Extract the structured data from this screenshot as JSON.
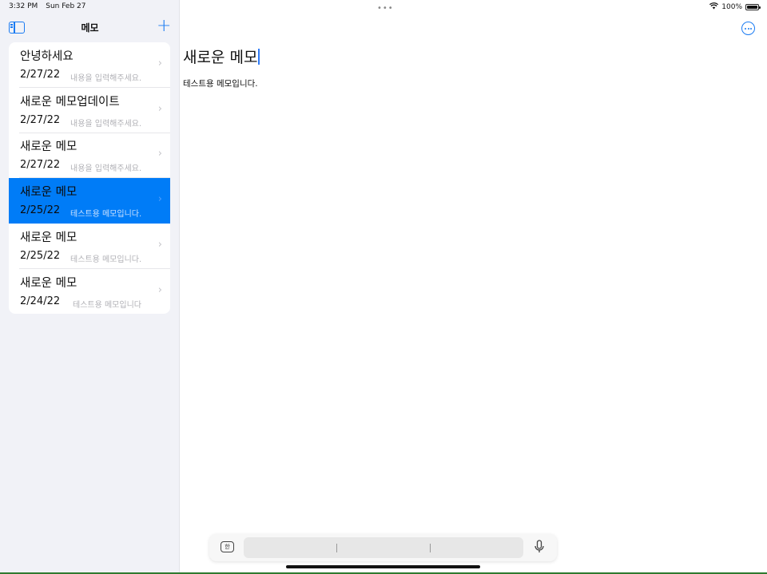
{
  "status": {
    "time": "3:32 PM",
    "date": "Sun Feb 27",
    "battery": "100%"
  },
  "sidebar": {
    "title": "메모",
    "toggle_icon": "sidebar-toggle-icon",
    "add_icon": "+",
    "items": [
      {
        "title": "안녕하세요",
        "date": "2/27/22",
        "preview": "내용을 입력해주세요."
      },
      {
        "title": "새로운 메모업데이트",
        "date": "2/27/22",
        "preview": "내용을 입력해주세요."
      },
      {
        "title": "새로운 메모",
        "date": "2/27/22",
        "preview": "내용을 입력해주세요."
      },
      {
        "title": "새로운 메모",
        "date": "2/25/22",
        "preview": "테스트용 메모입니다.",
        "selected": true
      },
      {
        "title": "새로운 메모",
        "date": "2/25/22",
        "preview": "테스트용 메모입니다."
      },
      {
        "title": "새로운 메모",
        "date": "2/24/22",
        "preview": "테스트용 메모입니다"
      }
    ],
    "chevron": "›"
  },
  "detail": {
    "title": "새로운 메모",
    "body": "테스트용 메모입니다."
  },
  "keyboard": {
    "lang_label": "한"
  },
  "colors": {
    "accent": "#1a7bf2",
    "selected": "#007cf7",
    "sidebar_bg": "#f1f2f7"
  }
}
